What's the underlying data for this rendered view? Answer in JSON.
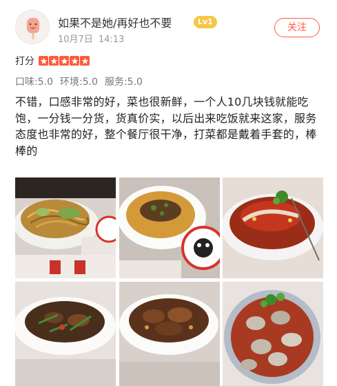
{
  "user": {
    "name": "如果不是她/再好也不要",
    "level": "Lv1",
    "date": "10月7日",
    "time": "14:13",
    "follow_label": "关注"
  },
  "rating": {
    "label": "打分",
    "stars": 5
  },
  "scores": [
    {
      "text": "口味:5.0"
    },
    {
      "text": "环境:5.0"
    },
    {
      "text": "服务:5.0"
    }
  ],
  "review": {
    "text": "不错，口感非常的好，菜也很新鲜，一个人10几块钱就能吃饱，一分钱一分货，货真价实，以后出来吃饭就来这家，服务态度也非常的好，整个餐厅很干净，打菜都是戴着手套的，棒棒的"
  },
  "photos": [
    {
      "name": "photo-stir-fried-noodles"
    },
    {
      "name": "photo-steamed-egg"
    },
    {
      "name": "photo-fish-chili"
    },
    {
      "name": "photo-stir-fried-pork"
    },
    {
      "name": "photo-braised-meat"
    },
    {
      "name": "photo-clams"
    }
  ],
  "colors": {
    "accent": "#ff5d3e",
    "star": "#ff5a3c",
    "badge": "#f6c744"
  }
}
